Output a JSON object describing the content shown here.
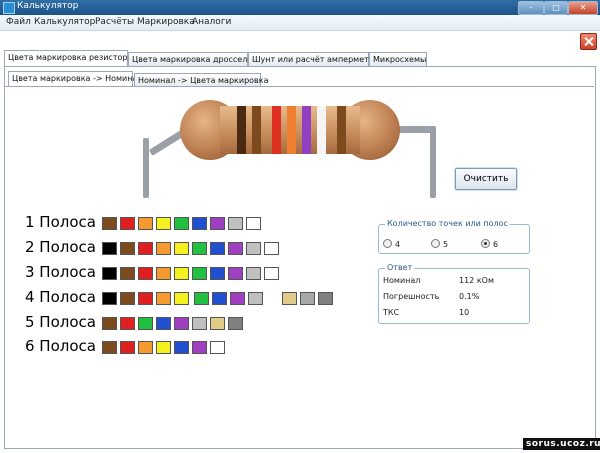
{
  "window": {
    "title": "Калькулятор"
  },
  "menu": [
    "Файл",
    "Калькулятор",
    "Расчёты",
    "Маркировка",
    "Аналоги"
  ],
  "main_tabs": [
    "Цвета маркировка резистора",
    "Цвета маркировка дросселя",
    "Шунт или расчёт амперметра",
    "Микросхемы"
  ],
  "sub_tabs": [
    "Цвета маркировка -> Номинал",
    "Номинал -> Цвета маркировка"
  ],
  "clear_button": "Очистить",
  "resistor_bands": [
    "#4a2a10",
    "#7b4a1e",
    "#e03020",
    "#f08030",
    "#9040c0",
    "#f5f5f5",
    "#7b4a1e"
  ],
  "rows": [
    {
      "label": "1 Полоса",
      "swatches": [
        "#7b4a1e",
        "#e02020",
        "#f59a30",
        "#f5f020",
        "#22c040",
        "#2050d0",
        "#a040c0",
        "#c0c0c0",
        "#ffffff"
      ]
    },
    {
      "label": "2 Полоса",
      "swatches": [
        "#000000",
        "#7b4a1e",
        "#e02020",
        "#f59a30",
        "#f5f020",
        "#22c040",
        "#2050d0",
        "#a040c0",
        "#c0c0c0",
        "#ffffff"
      ]
    },
    {
      "label": "3 Полоса",
      "swatches": [
        "#000000",
        "#7b4a1e",
        "#e02020",
        "#f59a30",
        "#f5f020",
        "#22c040",
        "#2050d0",
        "#a040c0",
        "#c0c0c0",
        "#ffffff"
      ]
    },
    {
      "label": "4 Полоса",
      "swatches": [
        "#000000",
        "#7b4a1e",
        "#e02020",
        "#f59a30",
        "#f5f020",
        "#22c040",
        "#2050d0",
        "#a040c0",
        "#c0c0c0",
        "#e0cc88",
        "#a8a8a8",
        "#808080"
      ]
    },
    {
      "label": "5 Полоса",
      "swatches": [
        "#7b4a1e",
        "#e02020",
        "#22c040",
        "#2050d0",
        "#a040c0",
        "#c0c0c0",
        "#e0cc88",
        "#808080"
      ]
    },
    {
      "label": "6 Полоса",
      "swatches": [
        "#7b4a1e",
        "#e02020",
        "#f59a30",
        "#f5f020",
        "#2050d0",
        "#a040c0",
        "#ffffff"
      ]
    }
  ],
  "points_group": {
    "title": "Количество точек или полос",
    "options": [
      "4",
      "5",
      "6"
    ],
    "selected": "6"
  },
  "answer_group": {
    "title": "Ответ",
    "rows": [
      {
        "label": "Номинал",
        "value": "112 кОм"
      },
      {
        "label": "Погрешность",
        "value": "0.1%"
      },
      {
        "label": "ТКС",
        "value": "10"
      }
    ]
  },
  "watermark": "sorus.ucoz.ru"
}
